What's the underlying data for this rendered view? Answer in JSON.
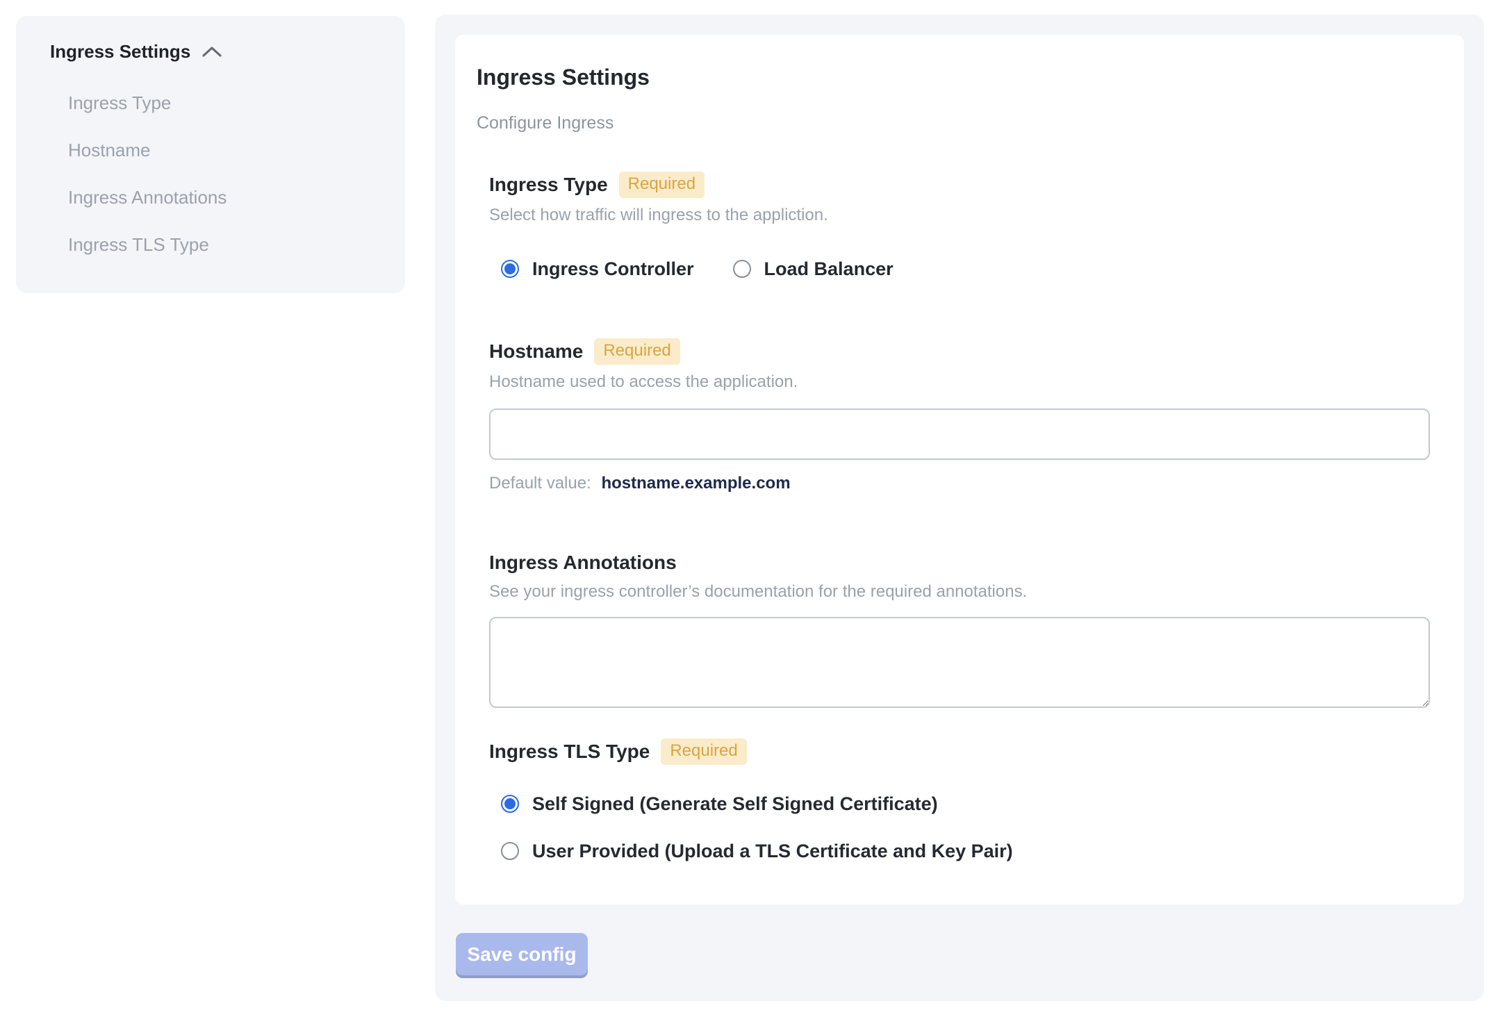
{
  "sidebar": {
    "title": "Ingress Settings",
    "items": [
      {
        "label": "Ingress Type"
      },
      {
        "label": "Hostname"
      },
      {
        "label": "Ingress Annotations"
      },
      {
        "label": "Ingress TLS Type"
      }
    ]
  },
  "panel": {
    "title": "Ingress Settings",
    "subtitle": "Configure Ingress",
    "required_label": "Required",
    "sections": {
      "ingress_type": {
        "label": "Ingress Type",
        "description": "Select how traffic will ingress to the appliction.",
        "options": [
          {
            "label": "Ingress Controller",
            "selected": true
          },
          {
            "label": "Load Balancer",
            "selected": false
          }
        ]
      },
      "hostname": {
        "label": "Hostname",
        "description": "Hostname used to access the application.",
        "value": "",
        "default_label": "Default value:",
        "default_value": "hostname.example.com"
      },
      "annotations": {
        "label": "Ingress Annotations",
        "description": "See your ingress controller’s documentation for the required annotations.",
        "value": ""
      },
      "tls_type": {
        "label": "Ingress TLS Type",
        "options": [
          {
            "label": "Self Signed (Generate Self Signed Certificate)",
            "selected": true
          },
          {
            "label": "User Provided (Upload a TLS Certificate and Key Pair)",
            "selected": false
          }
        ]
      }
    },
    "save_button": "Save config"
  },
  "colors": {
    "accent_blue": "#2b6be6",
    "badge_bg": "#faeccb",
    "badge_text": "#dba43e",
    "panel_bg": "#f4f5f8",
    "save_button_bg": "#aab9ec",
    "save_button_edge": "#8f9cca"
  },
  "icons": {
    "chevron_up": "chevron-up"
  }
}
